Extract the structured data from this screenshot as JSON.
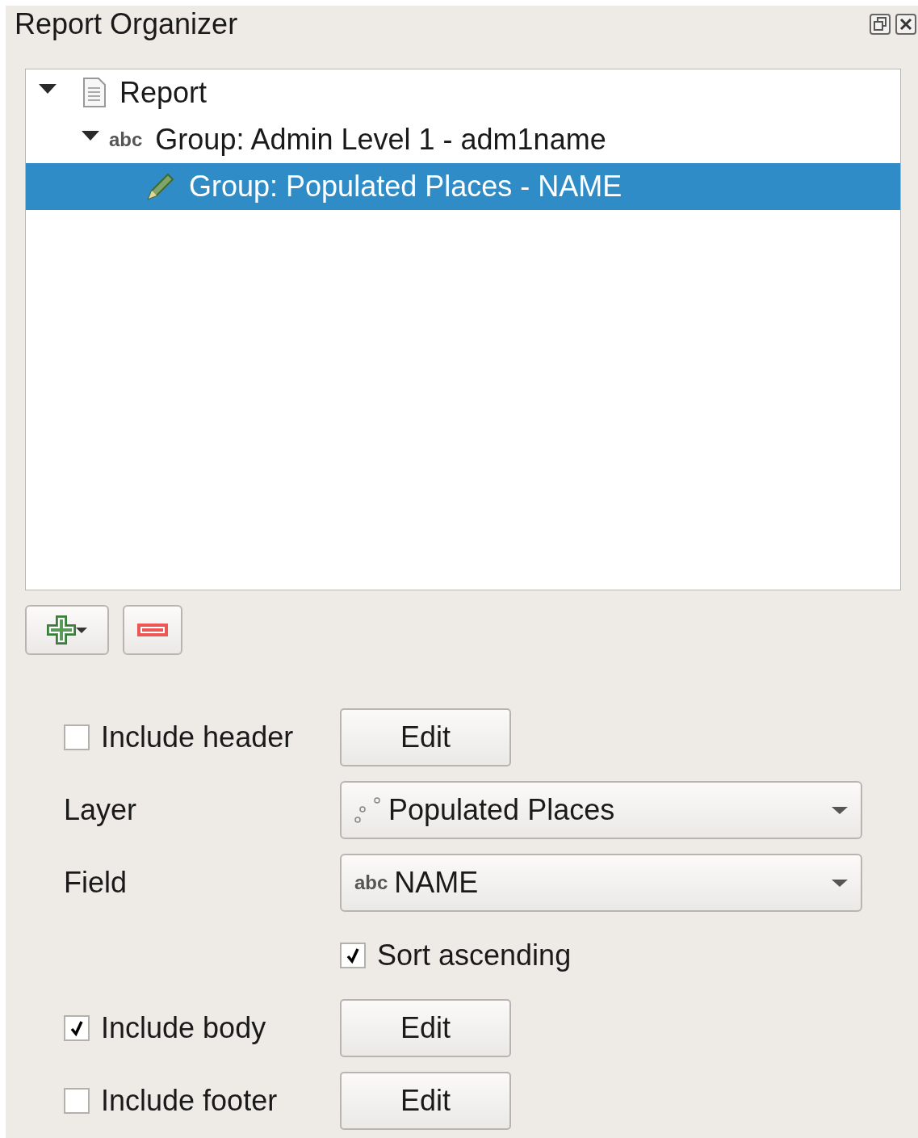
{
  "panel": {
    "title": "Report Organizer"
  },
  "tree": [
    {
      "label": "Report",
      "kind": "report",
      "expanded": true,
      "selected": false,
      "children": [
        {
          "label": "Group: Admin Level 1 - adm1name",
          "kind": "field-group",
          "badge": "abc",
          "expanded": true,
          "selected": false,
          "children": [
            {
              "label": "Group: Populated Places - NAME",
              "kind": "edit-group",
              "selected": true
            }
          ]
        }
      ]
    }
  ],
  "settings": [
    {
      "kind": "check-edit",
      "label": "Include header",
      "checked": false,
      "button": "Edit"
    },
    {
      "kind": "layer-combo",
      "label": "Layer",
      "value": "Populated Places"
    },
    {
      "kind": "field-combo",
      "label": "Field",
      "badge": "abc",
      "value": "NAME"
    },
    {
      "kind": "check",
      "label": "Sort ascending",
      "checked": true
    },
    {
      "kind": "check-edit",
      "label": "Include body",
      "checked": true,
      "button": "Edit"
    },
    {
      "kind": "check-edit",
      "label": "Include footer",
      "checked": false,
      "button": "Edit"
    }
  ]
}
